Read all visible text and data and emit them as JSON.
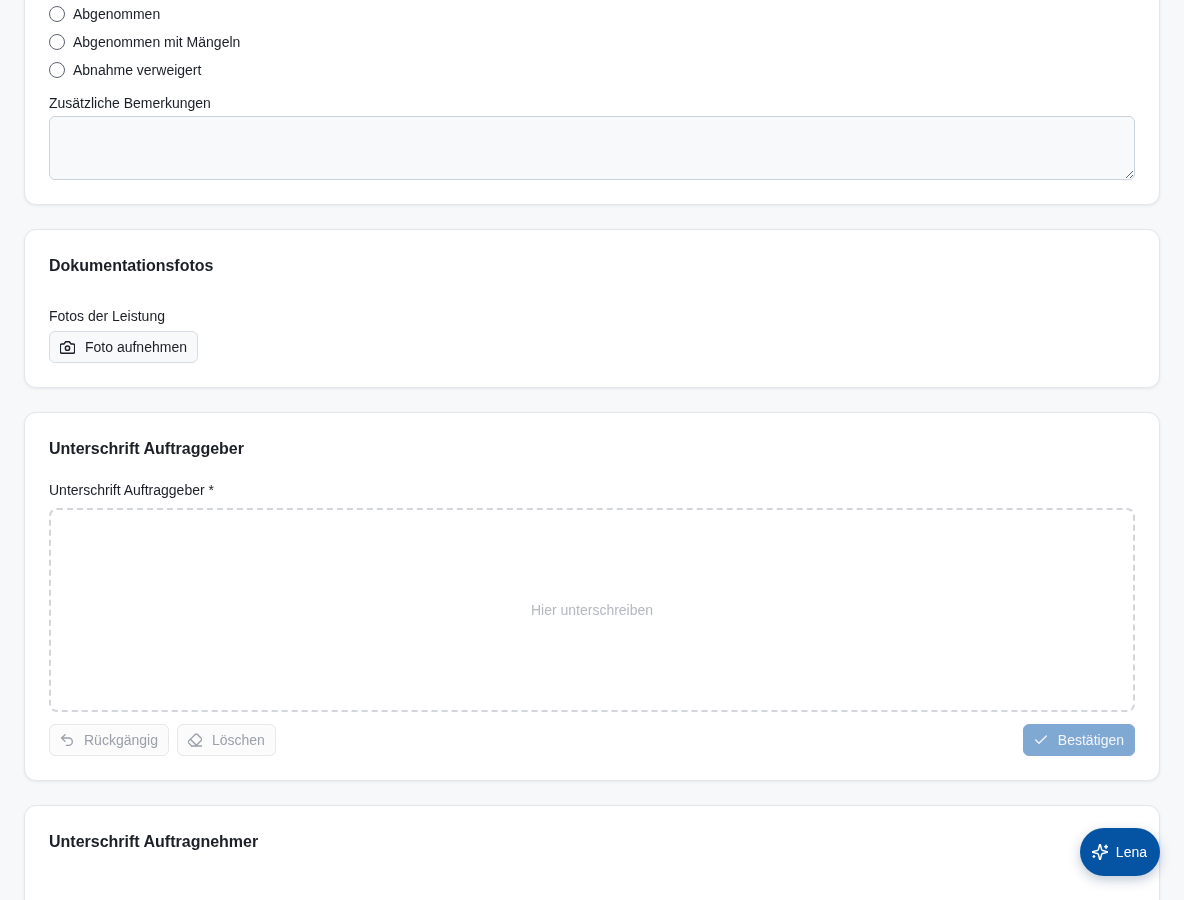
{
  "sections": [
    {
      "kind": "acceptance",
      "options": [
        {
          "label": "Abgenommen",
          "selected": false
        },
        {
          "label": "Abgenommen mit Mängeln",
          "selected": false
        },
        {
          "label": "Abnahme verweigert",
          "selected": false
        }
      ],
      "remarks": {
        "label": "Zusätzliche Bemerkungen"
      }
    },
    {
      "kind": "photos",
      "title": "Dokumentationsfotos",
      "field_label": "Fotos der Leistung",
      "button": {
        "label": "Foto aufnehmen"
      }
    },
    {
      "kind": "signature",
      "title": "Unterschrift Auftraggeber",
      "field_label": "Unterschrift Auftraggeber *",
      "placeholder": "Hier unterschreiben",
      "actions": [
        {
          "kind": "undo",
          "label": "Rückgängig",
          "disabled": true
        },
        {
          "kind": "clear",
          "label": "Löschen",
          "disabled": true
        },
        {
          "kind": "confirm",
          "label": "Bestätigen",
          "disabled": true
        }
      ]
    },
    {
      "kind": "signature",
      "title": "Unterschrift Auftragnehmer"
    }
  ],
  "assistant_button": {
    "label": "Lena"
  }
}
